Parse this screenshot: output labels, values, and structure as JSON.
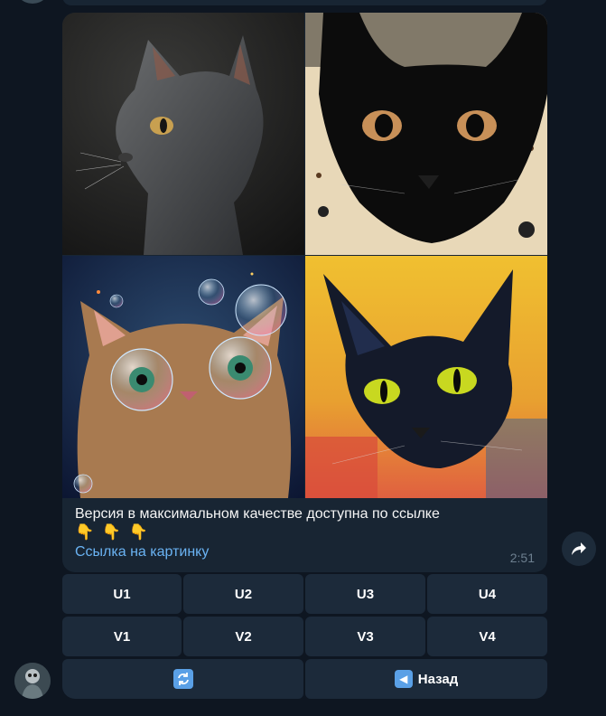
{
  "message": {
    "caption": "Версия в максимальном качестве доступна по ссылке",
    "emojis": "👇 👇 👇",
    "link_text": "Ссылка на картинку",
    "time": "2:51"
  },
  "images": [
    {
      "name": "grey-cat-image"
    },
    {
      "name": "black-cat-on-beige-image"
    },
    {
      "name": "bubble-cat-image"
    },
    {
      "name": "black-cat-on-yellow-image"
    }
  ],
  "keyboard": {
    "row1": [
      "U1",
      "U2",
      "U3",
      "U4"
    ],
    "row2": [
      "V1",
      "V2",
      "V3",
      "V4"
    ],
    "refresh_icon": "refresh-icon",
    "back_arrow": "◀",
    "back_label": "Назад"
  },
  "icons": {
    "share": "share-icon"
  },
  "colors": {
    "background": "#0e1621",
    "bubble": "#182533",
    "button": "#1c2a3a",
    "link": "#6ab3f3",
    "time": "#6d7f8f"
  }
}
